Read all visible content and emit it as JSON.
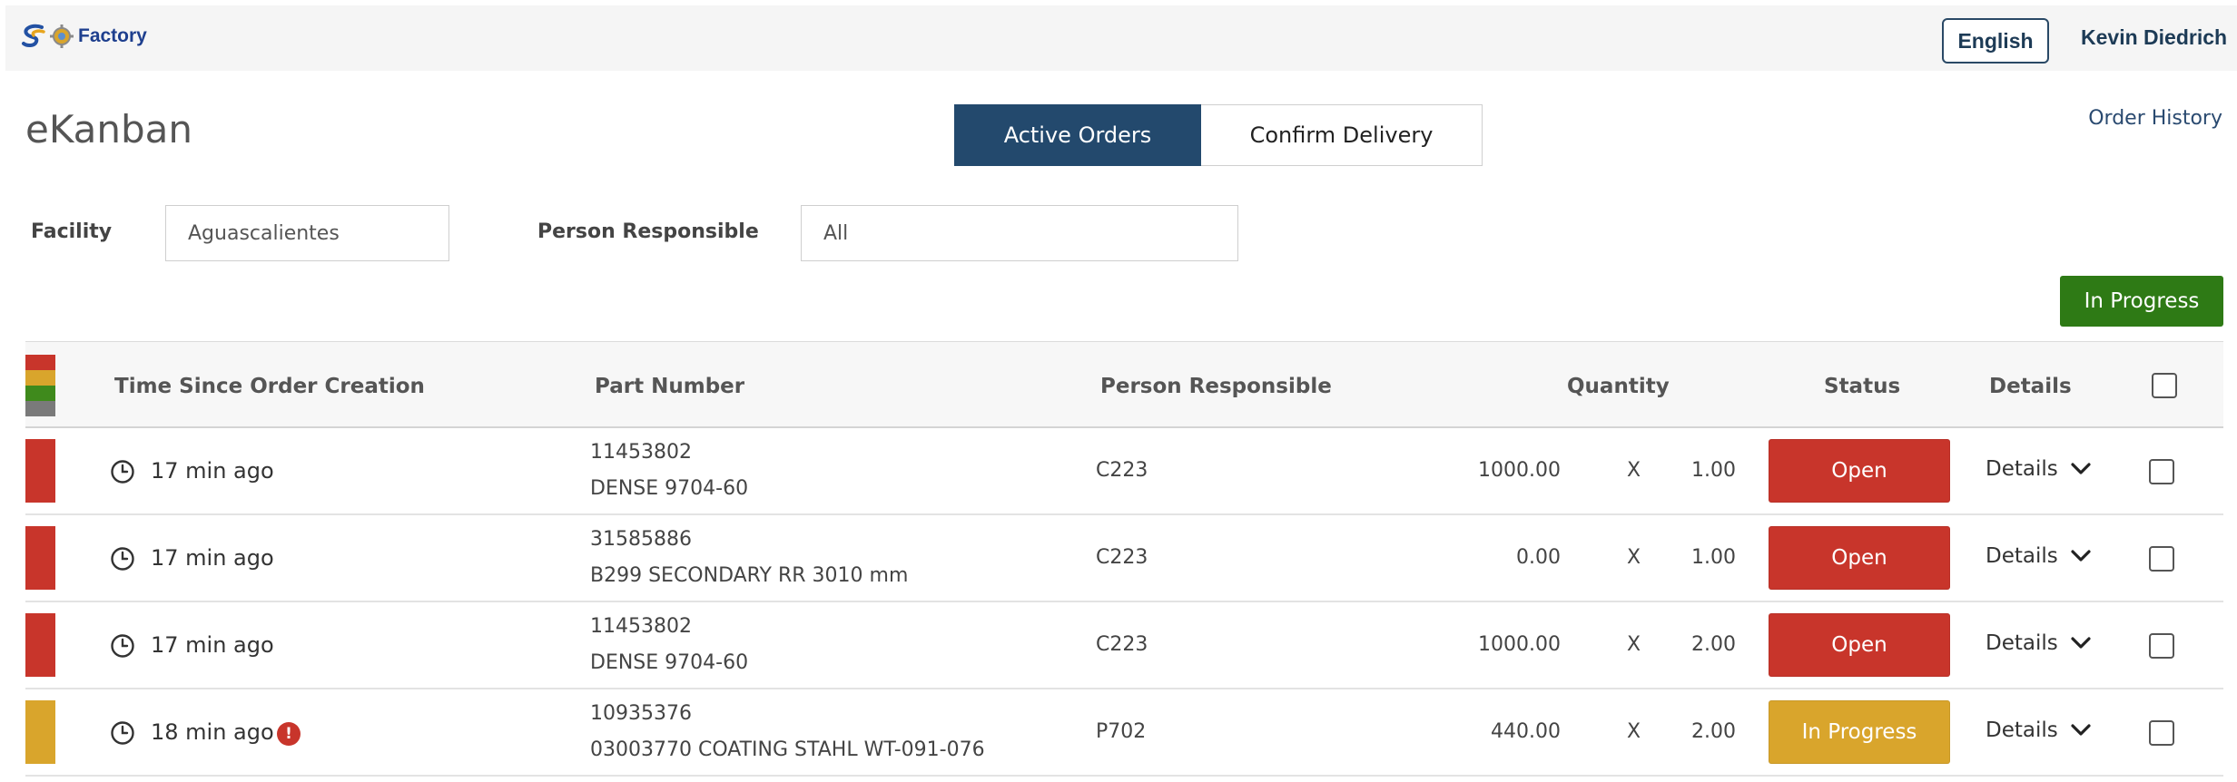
{
  "header": {
    "logo_text": "Factory",
    "language_button": "English",
    "user_name": "Kevin Diedrich"
  },
  "page": {
    "title": "eKanban",
    "order_history_link": "Order History"
  },
  "segmented": {
    "active_tab": "Active Orders",
    "inactive_tab": "Confirm Delivery"
  },
  "filters": {
    "facility_label": "Facility",
    "facility_value": "Aguascalientes",
    "person_label": "Person Responsible",
    "person_value": "All"
  },
  "action_button": "In Progress",
  "table": {
    "headers": {
      "time": "Time Since Order Creation",
      "part": "Part Number",
      "person": "Person Responsible",
      "quantity": "Quantity",
      "status": "Status",
      "details": "Details"
    },
    "legend_colors": [
      "#c8352b",
      "#d9a52c",
      "#3f8a1c",
      "#7a7a7a"
    ],
    "rows": [
      {
        "bar_color": "#c8352b",
        "time": "17 min ago",
        "alert": "",
        "part_number": "11453802",
        "part_desc": "DENSE 9704-60",
        "person": "C223",
        "quantity": "1000.00",
        "times": "X",
        "multiplier": "1.00",
        "status": "Open",
        "status_color": "#c8352b",
        "details": "Details"
      },
      {
        "bar_color": "#c8352b",
        "time": "17 min ago",
        "alert": "",
        "part_number": "31585886",
        "part_desc": "B299 SECONDARY RR 3010 mm",
        "person": "C223",
        "quantity": "0.00",
        "times": "X",
        "multiplier": "1.00",
        "status": "Open",
        "status_color": "#c8352b",
        "details": "Details"
      },
      {
        "bar_color": "#c8352b",
        "time": "17 min ago",
        "alert": "",
        "part_number": "11453802",
        "part_desc": "DENSE 9704-60",
        "person": "C223",
        "quantity": "1000.00",
        "times": "X",
        "multiplier": "2.00",
        "status": "Open",
        "status_color": "#c8352b",
        "details": "Details"
      },
      {
        "bar_color": "#d9a52c",
        "time": "18 min ago",
        "alert": "!",
        "part_number": "10935376",
        "part_desc": "03003770 COATING STAHL WT-091-076",
        "person": "P702",
        "quantity": "440.00",
        "times": "X",
        "multiplier": "2.00",
        "status": "In Progress",
        "status_color": "#d9a52c",
        "details": "Details"
      }
    ]
  }
}
